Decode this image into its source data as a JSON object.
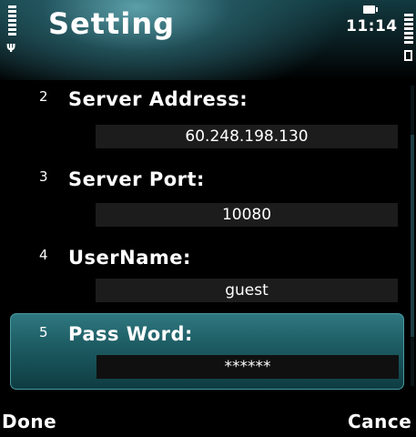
{
  "status": {
    "time": "11:14"
  },
  "header": {
    "title": "Setting"
  },
  "items": [
    {
      "number": "2",
      "label": "Server Address:",
      "value": "60.248.198.130"
    },
    {
      "number": "3",
      "label": "Server Port:",
      "value": "10080"
    },
    {
      "number": "4",
      "label": "UserName:",
      "value": "guest"
    },
    {
      "number": "5",
      "label": "Pass Word:",
      "value": "******"
    }
  ],
  "softkeys": {
    "left": "Done",
    "right": "Cance"
  },
  "colors": {
    "highlight": "#1e5d64",
    "background": "#000000",
    "field": "#1c1c1c"
  }
}
